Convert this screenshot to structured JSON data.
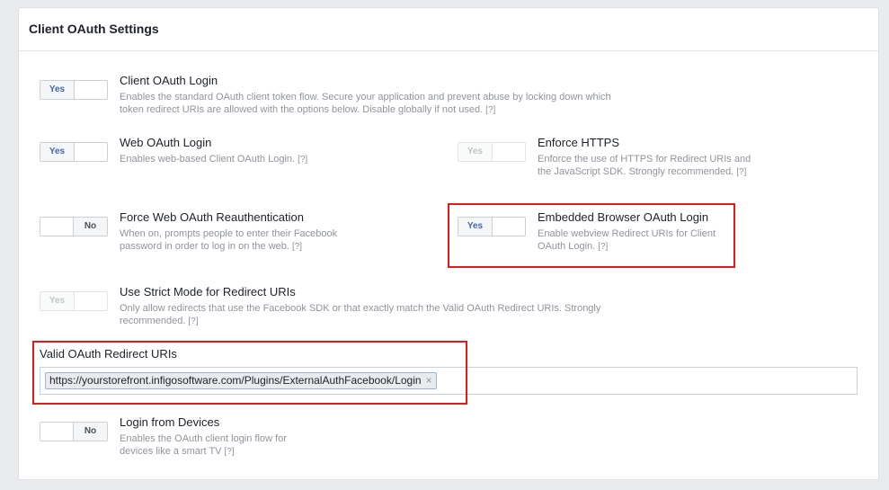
{
  "panel": {
    "title": "Client OAuth Settings"
  },
  "help_label": "[?]",
  "settings": {
    "client_oauth_login": {
      "toggle": "Yes",
      "title": "Client OAuth Login",
      "desc": "Enables the standard OAuth client token flow. Secure your application and prevent abuse by locking down which token redirect URIs are allowed with the options below. Disable globally if not used."
    },
    "web_oauth_login": {
      "toggle": "Yes",
      "title": "Web OAuth Login",
      "desc": "Enables web-based Client OAuth Login."
    },
    "enforce_https": {
      "toggle": "Yes",
      "title": "Enforce HTTPS",
      "desc": "Enforce the use of HTTPS for Redirect URIs and the JavaScript SDK. Strongly recommended."
    },
    "force_web_reauth": {
      "toggle": "No",
      "title": "Force Web OAuth Reauthentication",
      "desc": "When on, prompts people to enter their Facebook password in order to log in on the web."
    },
    "embedded_browser_login": {
      "toggle": "Yes",
      "title": "Embedded Browser OAuth Login",
      "desc": "Enable webview Redirect URIs for Client OAuth Login."
    },
    "strict_mode": {
      "toggle": "Yes",
      "title": "Use Strict Mode for Redirect URIs",
      "desc": "Only allow redirects that use the Facebook SDK or that exactly match the Valid OAuth Redirect URIs. Strongly recommended."
    },
    "login_from_devices": {
      "toggle": "No",
      "title": "Login from Devices",
      "desc": "Enables the OAuth client login flow for devices like a smart TV"
    }
  },
  "redirect_uris": {
    "label": "Valid OAuth Redirect URIs",
    "values": [
      "https://yourstorefront.infigosoftware.com/Plugins/ExternalAuthFacebook/Login"
    ],
    "remove_glyph": "×"
  },
  "colors": {
    "highlight": "#e01b1b",
    "accent": "#4267b2"
  }
}
